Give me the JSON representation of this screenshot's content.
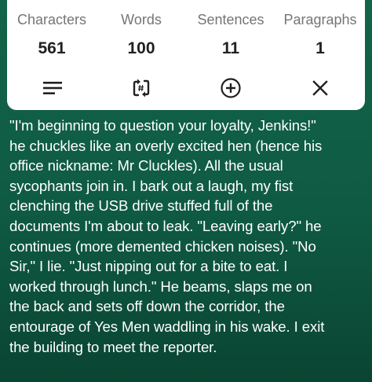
{
  "stats": {
    "characters": {
      "label": "Characters",
      "value": "561"
    },
    "words": {
      "label": "Words",
      "value": "100"
    },
    "sentences": {
      "label": "Sentences",
      "value": "11"
    },
    "paragraphs": {
      "label": "Paragraphs",
      "value": "1"
    }
  },
  "toolbar": {
    "icons": [
      "menu-lines-icon",
      "swap-count-icon",
      "add-circle-icon",
      "close-icon"
    ]
  },
  "text": {
    "lines": [
      "\"I'm beginning to question your loyalty, Jenkins!\"",
      "he chuckles like an overly excited hen (hence his",
      "office nickname: Mr Cluckles). All the usual",
      "sycophants join in. I bark out a laugh, my fist",
      "clenching the USB drive stuffed full of the",
      "documents I'm about to leak. \"Leaving early?\" he",
      "continues (more demented chicken noises). \"No",
      "Sir,\" I lie. \"Just nipping out for a bite to eat. I",
      "worked through lunch.\" He beams, slaps me on",
      "the back and sets  off down the corridor, the",
      "entourage of Yes Men waddling in his wake. I exit",
      "the building to meet the reporter."
    ]
  },
  "colors": {
    "background": "#10604a",
    "card": "#ffffff",
    "label": "#757575",
    "value": "#212121",
    "text": "#ffffff"
  }
}
